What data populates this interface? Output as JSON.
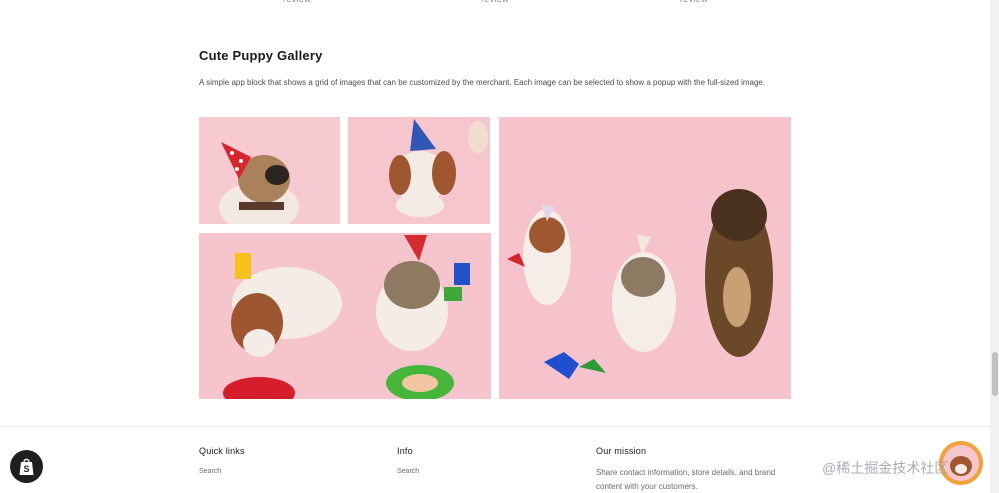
{
  "top_strip": {
    "items": [
      "review",
      "review",
      "review"
    ]
  },
  "gallery": {
    "title": "Cute Puppy Gallery",
    "description": "A simple app block that shows a grid of images that can be customized by the merchant. Each image can be selected to show a popup with the full-sized image.",
    "images": [
      {
        "name": "french-bulldog-party-hat"
      },
      {
        "name": "spaniel-party-hat"
      },
      {
        "name": "three-dogs-party"
      },
      {
        "name": "spaniel-and-bulldog-party"
      }
    ]
  },
  "footer": {
    "quick_links": {
      "heading": "Quick links",
      "link": "Search"
    },
    "info": {
      "heading": "Info",
      "link": "Search"
    },
    "mission": {
      "heading": "Our mission",
      "text": "Share contact information, store details, and brand content with your customers."
    }
  },
  "watermark": "@稀土掘金技术社区",
  "colors": {
    "background": "#ffffff",
    "tile_pink": "#f6c6cf",
    "badge": "#1f1f1f"
  }
}
